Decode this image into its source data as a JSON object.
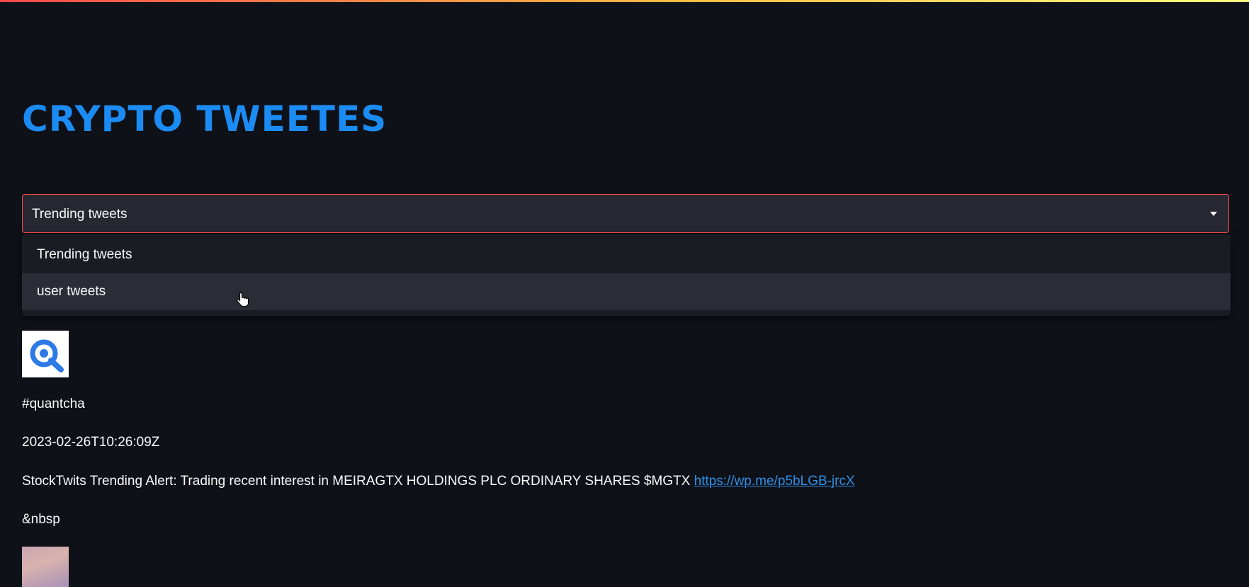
{
  "header": {
    "title": "CRYPTO TWEETES"
  },
  "select": {
    "selected": "Trending tweets",
    "options": [
      "Trending tweets",
      "user tweets"
    ],
    "hovered_index": 1
  },
  "tweets": [
    {
      "avatar_icon": "quantcha-logo-icon",
      "handle": "#quantcha",
      "timestamp": "2023-02-26T10:26:09Z",
      "text": "StockTwits Trending Alert: Trading recent interest in MEIRAGTX HOLDINGS PLC ORDINARY SHARES $MGTX ",
      "link": "https://wp.me/p5bLGB-jrcX",
      "separator": "&nbsp"
    }
  ],
  "colors": {
    "title": "#1c8cf5",
    "link": "#2f8fe6",
    "select_border": "#ff4b4b",
    "background": "#0e1117"
  }
}
